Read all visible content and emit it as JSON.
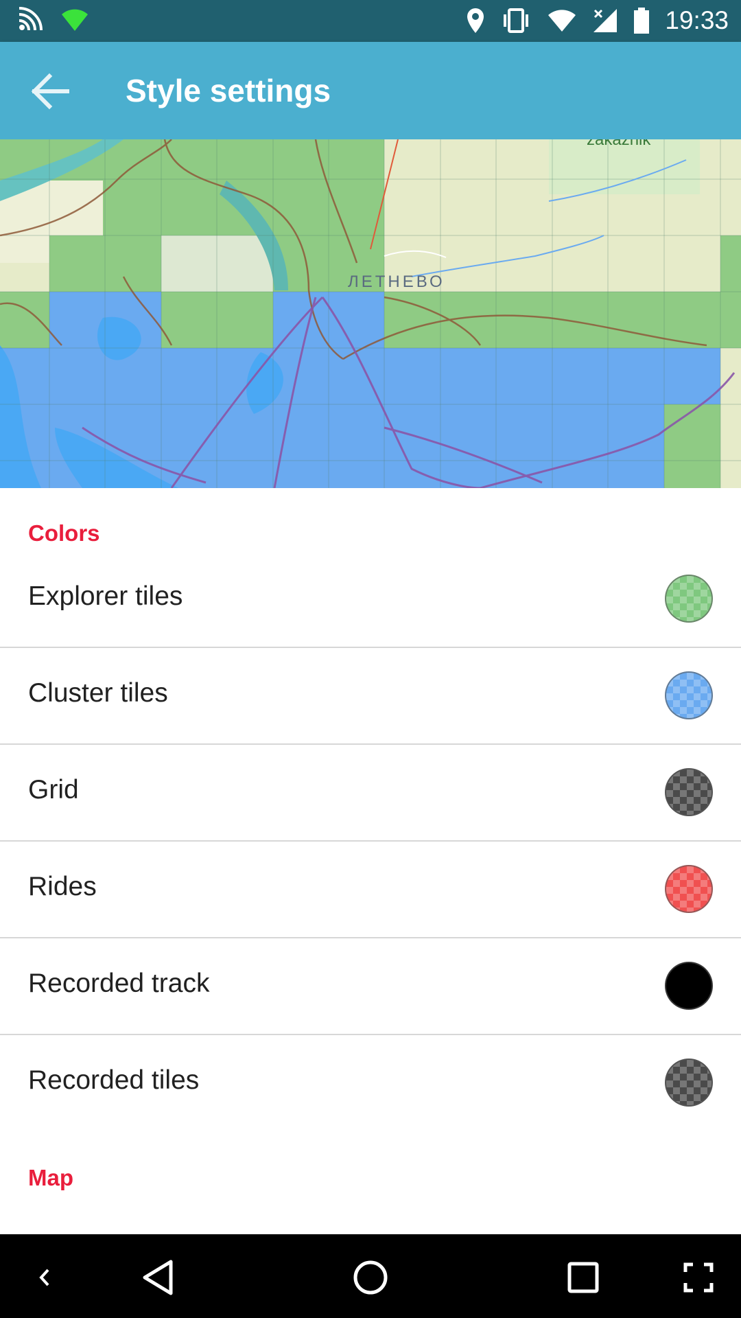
{
  "status_bar": {
    "time": "19:33",
    "icons": [
      "cast-icon",
      "wifi-icon",
      "location-icon",
      "vibrate-icon",
      "signal-wifi-icon",
      "cellular-icon",
      "battery-icon"
    ]
  },
  "app_bar": {
    "title": "Style settings",
    "back_icon": "arrow-back-icon",
    "background_color": "#4bafcf"
  },
  "map": {
    "place_label": "ЛЕТНЕВО",
    "top_label": "zakaznik"
  },
  "sections": {
    "colors_header": "Colors",
    "map_header": "Map"
  },
  "color_prefs": [
    {
      "label": "Explorer tiles",
      "color": "#7fc87f"
    },
    {
      "label": "Cluster tiles",
      "color": "#6aaaf0"
    },
    {
      "label": "Grid",
      "color": "#4a4a4a"
    },
    {
      "label": "Rides",
      "color": "#f05050"
    },
    {
      "label": "Recorded track",
      "color": "#000000"
    },
    {
      "label": "Recorded tiles",
      "color": "#4a4a4a"
    }
  ],
  "nav_bar": {
    "icons": [
      "collapse-icon",
      "back-triangle-icon",
      "home-circle-icon",
      "recents-square-icon",
      "fullscreen-icon"
    ]
  },
  "colors": {
    "accent": "#e91e3c",
    "status_bar": "#20606f"
  }
}
